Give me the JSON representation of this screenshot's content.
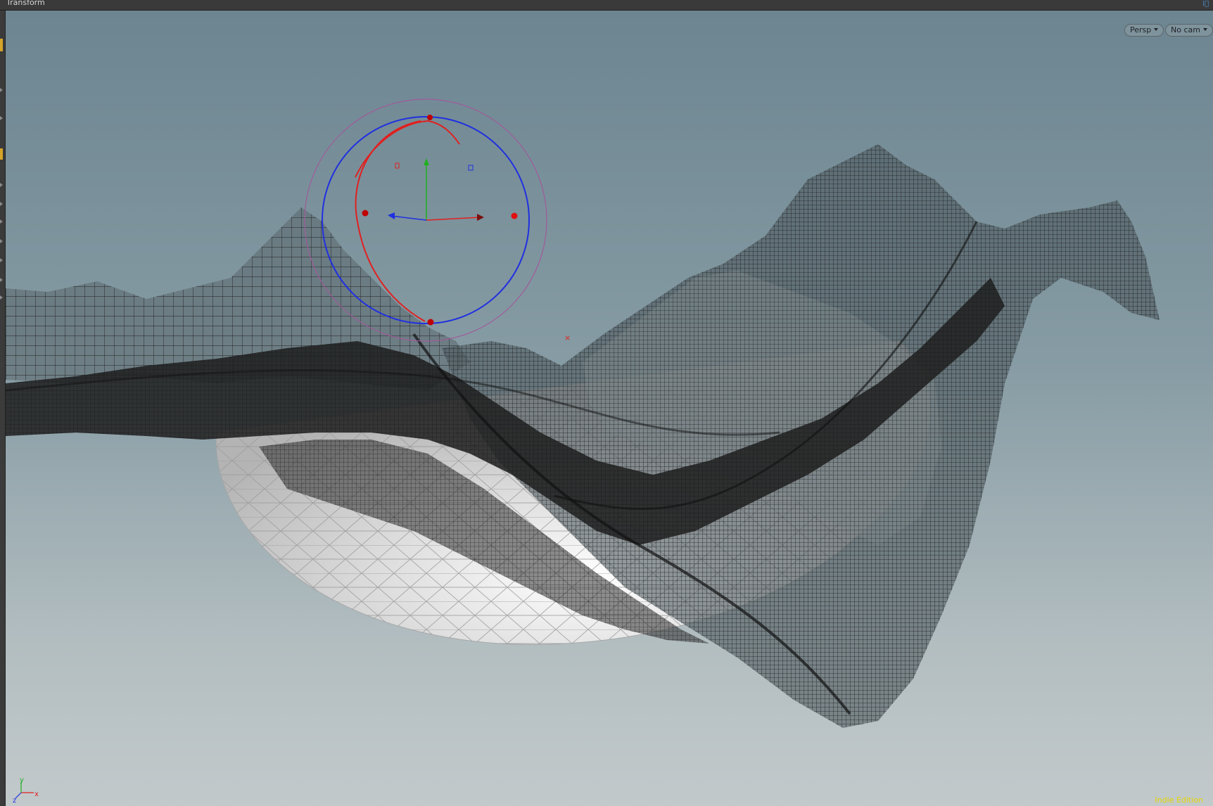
{
  "window": {
    "title": "Transform",
    "corner_icon": "network-pin-icon"
  },
  "viewport": {
    "view_menu_label": "Persp",
    "camera_menu_label": "No cam",
    "edition_label": "Indie Edition",
    "axes": {
      "x_label": "x",
      "y_label": "y",
      "z_label": "z"
    },
    "colors": {
      "background_top": "#6c8591",
      "background_bottom": "#c2c9cb",
      "wireframe": "#202020",
      "sphere": "#d8d8d8",
      "handle_x": "#e02020",
      "handle_y": "#20b020",
      "handle_z": "#2030e0",
      "handle_outer": "#a05a9a",
      "edition_text": "#e3d400"
    }
  }
}
